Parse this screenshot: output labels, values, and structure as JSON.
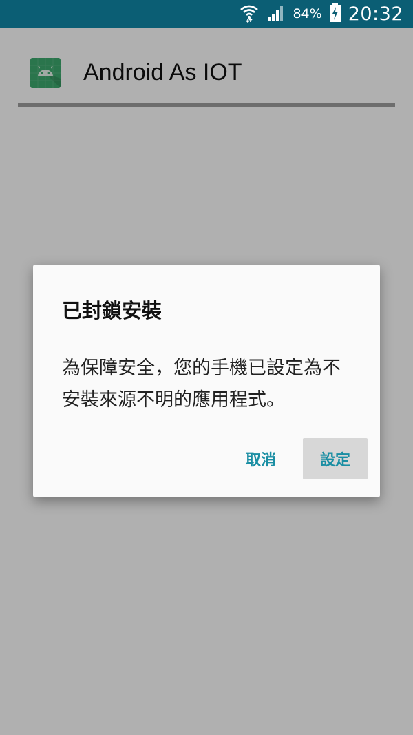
{
  "status_bar": {
    "battery_percent": "84%",
    "time": "20:32"
  },
  "app": {
    "title": "Android As IOT",
    "icon": "android-robot-icon"
  },
  "dialog": {
    "title": "已封鎖安裝",
    "message": "為保障安全，您的手機已設定為不安裝來源不明的應用程式。",
    "cancel_label": "取消",
    "settings_label": "設定"
  },
  "colors": {
    "status_bar": "#0b5e74",
    "accent": "#1a8ea3",
    "app_icon": "#3daa6e"
  }
}
